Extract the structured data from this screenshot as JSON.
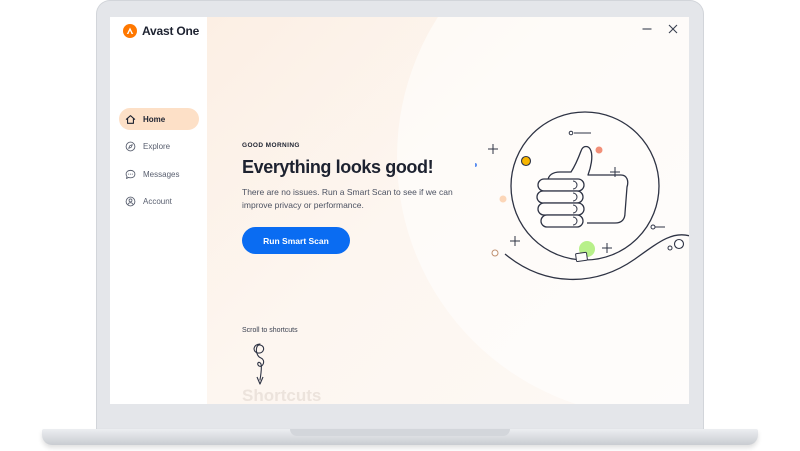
{
  "app": {
    "name": "Avast One",
    "brand_color": "#ff7800"
  },
  "window_controls": {
    "minimize_icon": "minimize-icon",
    "close_icon": "close-icon"
  },
  "sidebar": {
    "items": [
      {
        "label": "Home",
        "icon": "home-icon",
        "active": true
      },
      {
        "label": "Explore",
        "icon": "compass-icon",
        "active": false
      },
      {
        "label": "Messages",
        "icon": "chat-bubble-icon",
        "active": false
      },
      {
        "label": "Account",
        "icon": "user-icon",
        "active": false
      }
    ]
  },
  "main": {
    "greeting": "GOOD MORNING",
    "headline_prefix": "Everything ",
    "headline_highlight": "looks good!",
    "subtext": "There are no issues. Run a Smart Scan to see if we can improve privacy or performance.",
    "scan_button_label": "Run Smart Scan",
    "scroll_label": "Scroll to shortcuts",
    "shortcuts_title": "Shortcuts"
  },
  "colors": {
    "accent": "#0a6cf2",
    "highlight": "#b8f08a",
    "active_nav": "#fde0c7"
  }
}
